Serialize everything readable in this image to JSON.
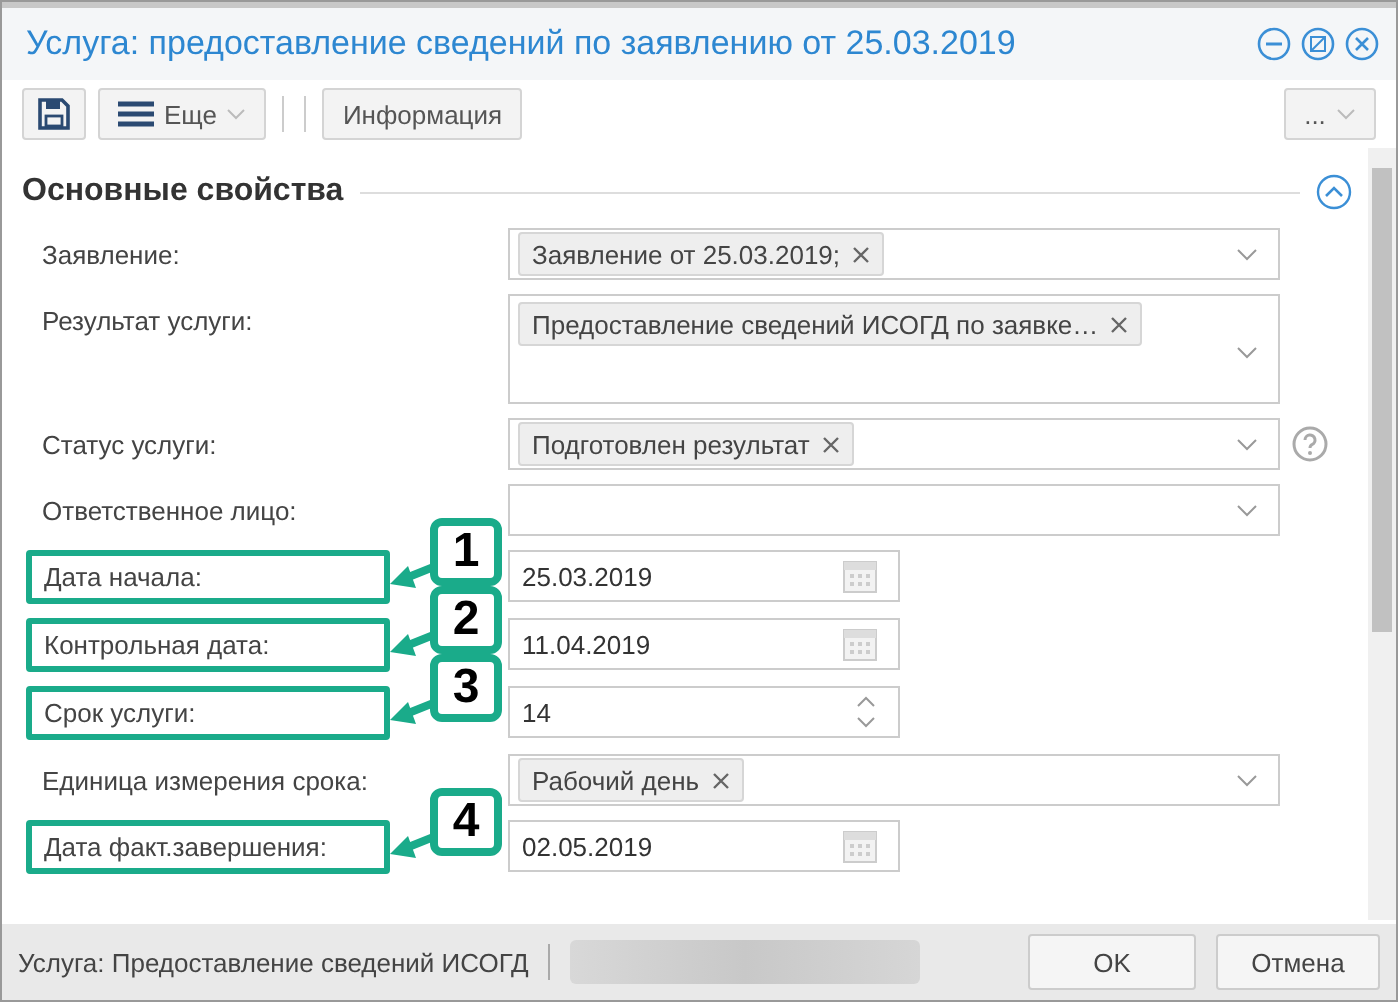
{
  "window": {
    "title": "Услуга: предоставление сведений по заявлению от 25.03.2019"
  },
  "toolbar": {
    "more": "Еще",
    "info": "Информация",
    "overflow": "..."
  },
  "section": {
    "title": "Основные свойства",
    "expanded": true
  },
  "fields": [
    {
      "kind": "tags",
      "label": "Заявление:",
      "tags": [
        "Заявление от 25.03.2019;"
      ]
    },
    {
      "kind": "tall_tags",
      "label": "Результат услуги:",
      "tags": [
        "Предоставление сведений ИСОГД по заявке…"
      ]
    },
    {
      "kind": "tags",
      "label": "Статус услуги:",
      "tags": [
        "Подготовлен результат"
      ],
      "help": true
    },
    {
      "kind": "select",
      "label": "Ответственное лицо:"
    },
    {
      "kind": "date",
      "label": "Дата начала:",
      "value": "25.03.2019",
      "callout": "1"
    },
    {
      "kind": "date",
      "label": "Контрольная дата:",
      "value": "11.04.2019",
      "callout": "2"
    },
    {
      "kind": "spin",
      "label": "Срок услуги:",
      "value": "14",
      "callout": "3"
    },
    {
      "kind": "tags",
      "label": "Единица измерения срока:",
      "tags": [
        "Рабочий день"
      ]
    },
    {
      "kind": "date",
      "label": "Дата факт.завершения:",
      "value": "02.05.2019",
      "callout": "4"
    }
  ],
  "status_bar": {
    "text": "Услуга: Предоставление сведений ИСОГД",
    "buttons": [
      "OK",
      "Отмена"
    ]
  }
}
